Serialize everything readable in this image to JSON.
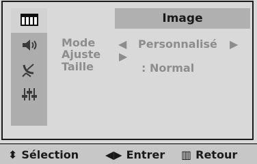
{
  "menu": {
    "title": "Image",
    "items": [
      {
        "icon": "tv-grid-icon"
      },
      {
        "icon": "speaker-icon"
      },
      {
        "icon": "satellite-dish-icon"
      },
      {
        "icon": "equalizer-sliders-icon"
      },
      {
        "icon": "empty"
      }
    ]
  },
  "settings": {
    "mode_label": "Mode",
    "mode_value": "Personnalisé",
    "ajuste_label": "Ajuste",
    "taille_label": "Taille",
    "taille_value": ": Normal"
  },
  "footer": {
    "select": "Sélection",
    "enter": "Entrer",
    "back": "Retour"
  }
}
